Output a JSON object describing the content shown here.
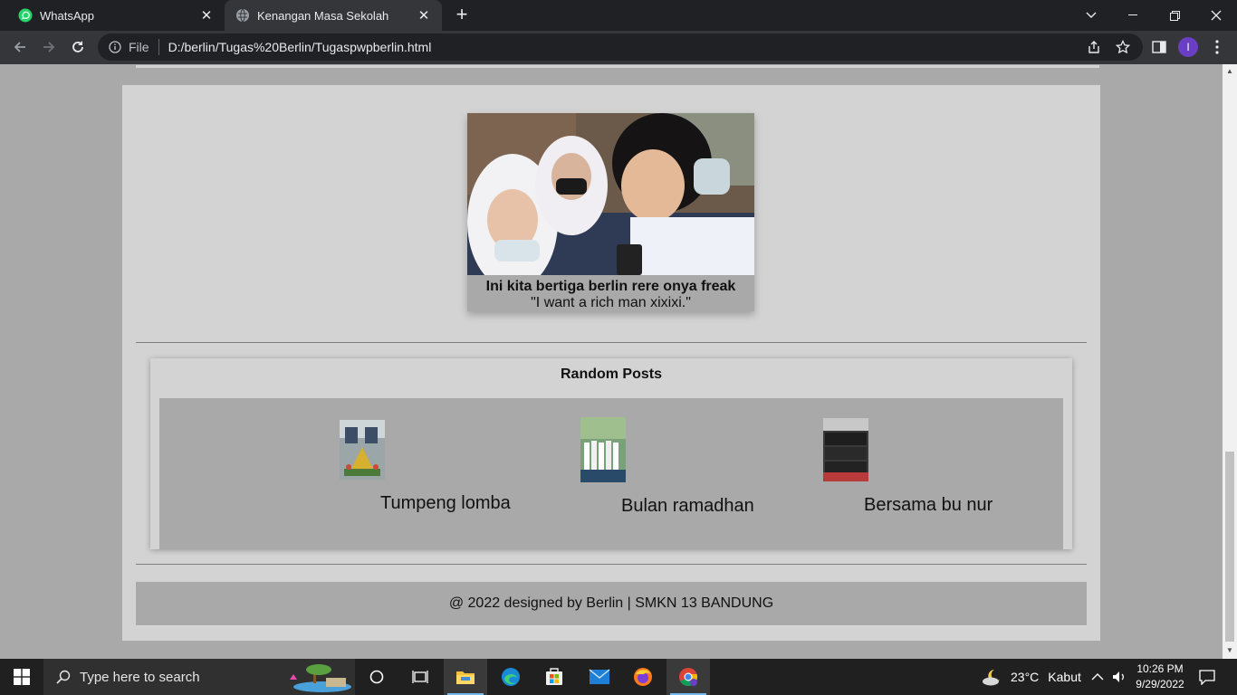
{
  "browser": {
    "tabs": [
      {
        "title": "WhatsApp",
        "active": false
      },
      {
        "title": "Kenangan Masa Sekolah",
        "active": true
      }
    ],
    "address": {
      "security_label": "File",
      "url": "D:/berlin/Tugas%20Berlin/Tugaspwpberlin.html"
    },
    "profile_initial": "I"
  },
  "featured": {
    "caption_title": "Ini kita bertiga berlin rere onya freak",
    "caption_quote": "\"I want a rich man xixixi.\""
  },
  "random_posts": {
    "heading": "Random Posts",
    "items": [
      {
        "label": "Tumpeng lomba"
      },
      {
        "label": "Bulan ramadhan"
      },
      {
        "label": "Bersama bu nur"
      }
    ]
  },
  "footer": {
    "text": "@ 2022 designed by Berlin | SMKN 13 BANDUNG"
  },
  "taskbar": {
    "search_placeholder": "Type here to search",
    "weather_temp": "23°C",
    "weather_desc": "Kabut",
    "time": "10:26 PM",
    "date": "9/29/2022"
  },
  "colors": {
    "page_bg": "#a9a9a9",
    "panel_bg": "#d3d3d3",
    "chrome_dark": "#202124",
    "chrome_toolbar": "#35363a"
  }
}
